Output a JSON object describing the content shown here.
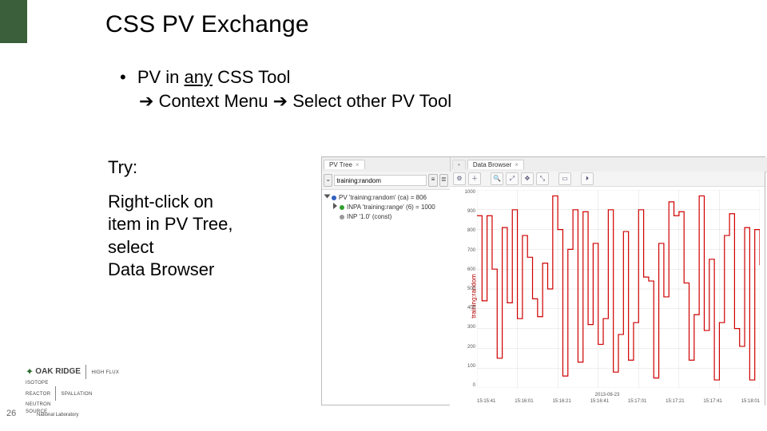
{
  "title": "CSS PV Exchange",
  "bullet": {
    "line1_pre": "PV in ",
    "line1_underlined": "any",
    "line1_post": " CSS Tool",
    "line2": "Context Menu ",
    "line2_b": " Select other PV Tool"
  },
  "try": {
    "label": "Try:",
    "body1": "Right-click on",
    "body2": "item in PV Tree,",
    "body3": "select",
    "body4": "Data Browser"
  },
  "page_number": "26",
  "footer": {
    "lab": "OAK RIDGE",
    "lab_sub": "National Laboratory",
    "div1a": "HIGH FLUX",
    "div1b": "ISOTOPE",
    "div1c": "REACTOR",
    "div2a": "SPALLATION",
    "div2b": "NEUTRON",
    "div2c": "SOURCE"
  },
  "app": {
    "tabs": {
      "left": "PV Tree",
      "right": "Data Browser"
    },
    "search_value": "training:random",
    "tree": {
      "root": "PV 'training:random' (ca) = 806",
      "child1": "INPA 'training:range' (6) = 1000",
      "child2": "INP '1.0' (const)"
    },
    "chart": {
      "ylabel": "training:random"
    }
  },
  "chart_data": {
    "type": "line",
    "title": "",
    "xlabel": "2013-08-23",
    "ylabel": "training:random",
    "ylim": [
      0,
      1000
    ],
    "x_ticks": [
      "15:15:41",
      "15:16:01",
      "15:16:21",
      "15:16:41",
      "15:17:01",
      "15:17:21",
      "15:17:41",
      "15:18:01"
    ],
    "y_ticks": [
      0,
      100,
      200,
      300,
      400,
      500,
      600,
      700,
      800,
      900,
      1000
    ],
    "series": [
      {
        "name": "training:random",
        "color": "#d00000",
        "step": true,
        "values": [
          870,
          440,
          870,
          600,
          150,
          810,
          430,
          900,
          350,
          770,
          660,
          450,
          360,
          630,
          500,
          970,
          800,
          60,
          700,
          900,
          130,
          890,
          320,
          730,
          220,
          350,
          900,
          80,
          270,
          790,
          140,
          330,
          900,
          560,
          540,
          50,
          730,
          460,
          940,
          870,
          890,
          530,
          140,
          370,
          970,
          290,
          650,
          40,
          330,
          770,
          880,
          300,
          210,
          810,
          40,
          800,
          620
        ]
      }
    ]
  }
}
